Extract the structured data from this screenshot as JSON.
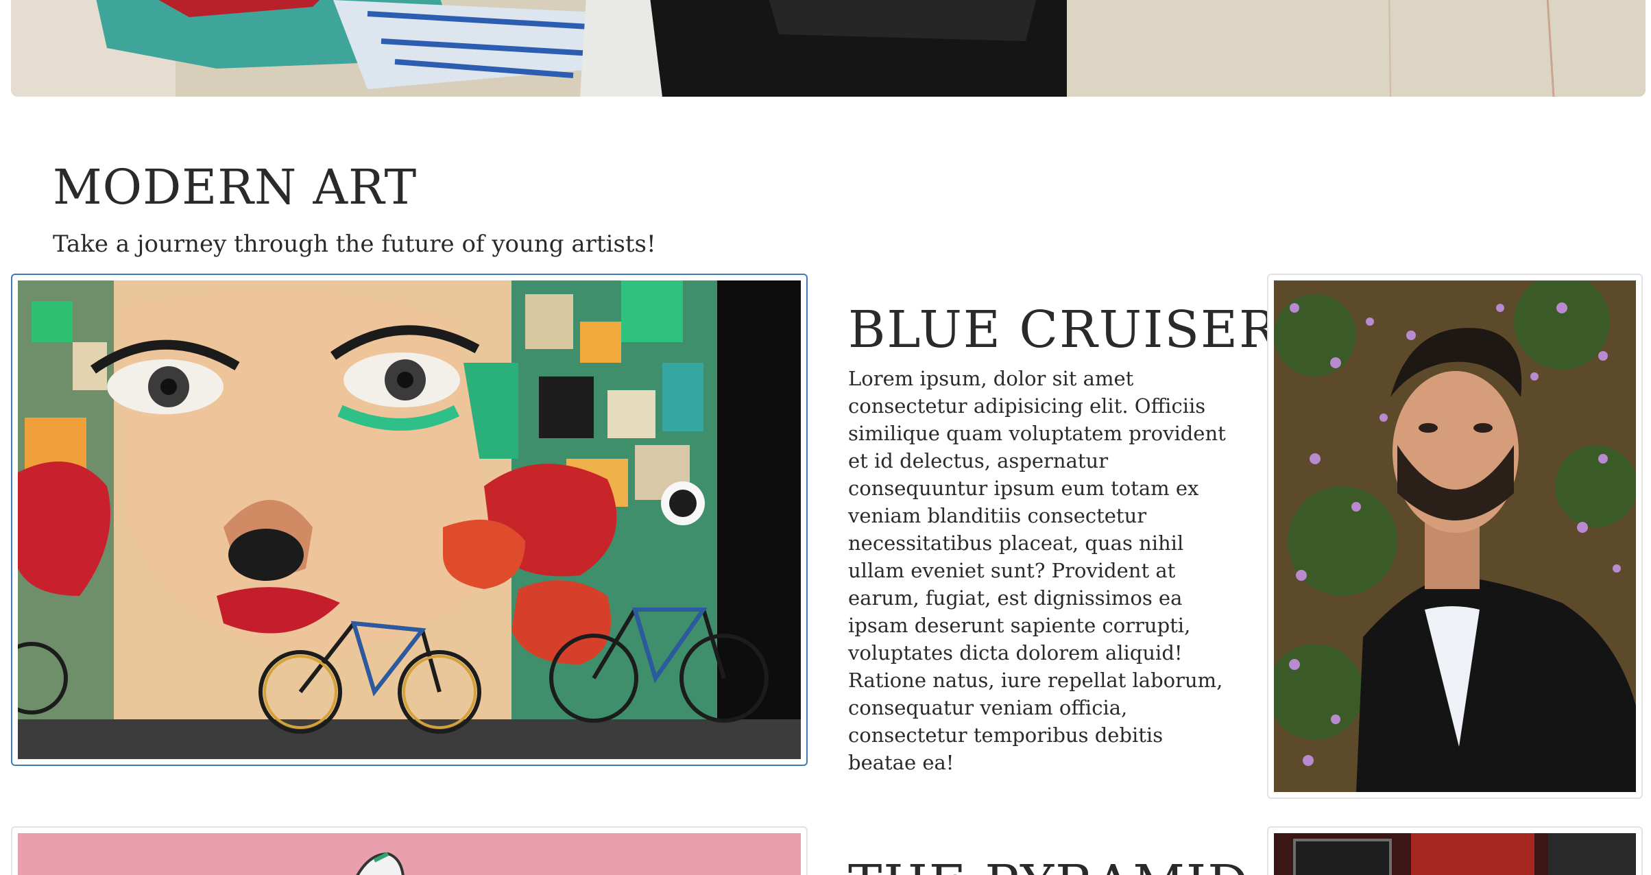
{
  "section": {
    "title": "MODERN ART",
    "subtitle": "Take a journey through the future of young artists!"
  },
  "artworks": [
    {
      "title": "BLUE CRUISER",
      "description": "Lorem ipsum, dolor sit amet consectetur adipisicing elit. Officiis similique quam voluptatem provident et id delectus, aspernatur consequuntur ipsum eum totam ex veniam blanditiis consectetur necessitatibus placeat, quas nihil ullam eveniet sunt? Provident at earum, fugiat, est dignissimos ea ipsam deserunt sapiente corrupti, voluptates dicta dolorem aliquid! Ratione natus, iure repellat laborum, consequatur veniam officia, consectetur temporibus debitis beatae ea!",
      "art_image_icon": "graffiti-mural-bicycles-image",
      "portrait_icon": "man-portrait-image"
    },
    {
      "title": "THE PYRAMID",
      "art_image_icon": "pink-wall-mural-image",
      "portrait_icon": "red-interior-image"
    }
  ],
  "colors": {
    "active_border": "#3d7ab8",
    "frame_border": "#e2e2e2",
    "text": "#2a2a2a"
  }
}
